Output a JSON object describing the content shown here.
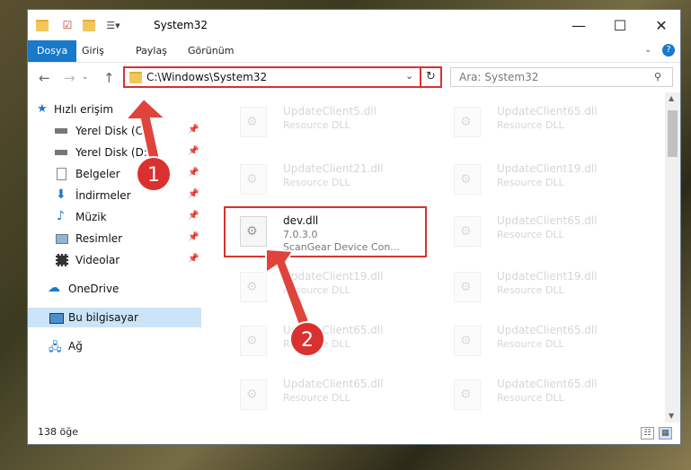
{
  "window": {
    "title": "System32"
  },
  "ribbon": {
    "tabs": [
      "Dosya",
      "Giriş",
      "Paylaş",
      "Görünüm"
    ]
  },
  "address": {
    "path": "C:\\Windows\\System32"
  },
  "search": {
    "placeholder": "Ara: System32"
  },
  "sidebar": {
    "items": [
      {
        "label": "Hızlı erişim",
        "icon": "star-icon"
      },
      {
        "label": "Yerel Disk (C:)",
        "icon": "drive-icon",
        "pinned": true
      },
      {
        "label": "Yerel Disk (D:)",
        "icon": "drive-icon",
        "pinned": true
      },
      {
        "label": "Belgeler",
        "icon": "documents-icon",
        "pinned": true
      },
      {
        "label": "İndirmeler",
        "icon": "download-icon",
        "pinned": true
      },
      {
        "label": "Müzik",
        "icon": "music-icon",
        "pinned": true
      },
      {
        "label": "Resimler",
        "icon": "pictures-icon",
        "pinned": true
      },
      {
        "label": "Videolar",
        "icon": "videos-icon",
        "pinned": true
      },
      {
        "label": "OneDrive",
        "icon": "cloud-icon"
      },
      {
        "label": "Bu bilgisayar",
        "icon": "computer-icon",
        "selected": true
      },
      {
        "label": "Ağ",
        "icon": "network-icon"
      }
    ]
  },
  "files": [
    {
      "name": "UpdateClient5.dll",
      "type": "Resource DLL"
    },
    {
      "name": "UpdateClient65.dll",
      "type": "Resource DLL"
    },
    {
      "name": "UpdateClient21.dll",
      "type": "Resource DLL"
    },
    {
      "name": "UpdateClient19.dll",
      "type": "Resource DLL"
    },
    {
      "name": "dev.dll",
      "version": "7.0.3.0",
      "desc": "ScanGear Device Con..."
    },
    {
      "name": "UpdateClient65.dll",
      "type": "Resource DLL"
    },
    {
      "name": "UpdateClient19.dll",
      "type": "Resource DLL"
    },
    {
      "name": "UpdateClient19.dll",
      "type": "Resource DLL"
    },
    {
      "name": "UpdateClient65.dll",
      "type": "Resource DLL"
    },
    {
      "name": "UpdateClient65.dll",
      "type": "Resource DLL"
    },
    {
      "name": "UpdateClient65.dll",
      "type": "Resource DLL"
    },
    {
      "name": "UpdateClient65.dll",
      "type": "Resource DLL"
    }
  ],
  "status": {
    "count": "138 öğe"
  },
  "callouts": [
    "1",
    "2"
  ],
  "colors": {
    "accent": "#1979ca",
    "highlight": "#d9312f",
    "selected": "#cce4f7"
  }
}
